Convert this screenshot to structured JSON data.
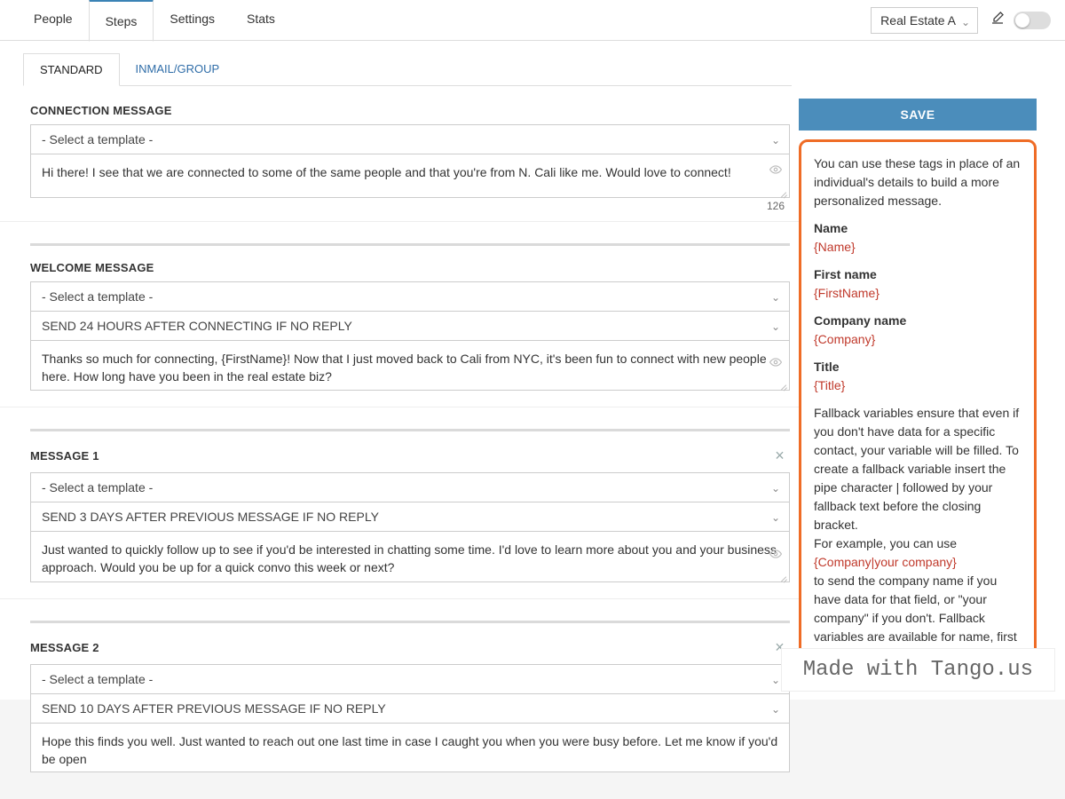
{
  "nav": {
    "people": "People",
    "steps": "Steps",
    "settings": "Settings",
    "stats": "Stats"
  },
  "campaign_selected": "Real Estate A",
  "secondary_tabs": {
    "standard": "STANDARD",
    "inmail": "INMAIL/GROUP"
  },
  "select_template_placeholder": "- Select a template -",
  "connection": {
    "title": "CONNECTION MESSAGE",
    "body": "Hi there! I see that we are connected to some of the same people and that you're from N. Cali like me. Would love to connect!",
    "count": "126"
  },
  "welcome": {
    "title": "WELCOME MESSAGE",
    "timing": "SEND 24 HOURS AFTER CONNECTING IF NO REPLY",
    "body": "Thanks so much for connecting, {FirstName}! Now that I just moved back to Cali from NYC, it's been fun to connect with new people here. How long have you been in the real estate biz?"
  },
  "msg1": {
    "title": "MESSAGE 1",
    "timing": "SEND 3 DAYS AFTER PREVIOUS MESSAGE IF NO REPLY",
    "body": "Just wanted to quickly follow up to see if you'd be interested in chatting some time. I'd love to learn more about you and your business approach. Would you be up for a quick convo this week or next?"
  },
  "msg2": {
    "title": "MESSAGE 2",
    "timing": "SEND 10 DAYS AFTER PREVIOUS MESSAGE IF NO REPLY",
    "body": "Hope this finds you well. Just wanted to reach out one last time in case I caught you when you were busy before. Let me know if you'd be open"
  },
  "save_label": "SAVE",
  "help": {
    "intro": "You can use these tags in place of an individual's details to build a more personalized message.",
    "name_lbl": "Name",
    "name_tag": "{Name}",
    "first_lbl": "First name",
    "first_tag": "{FirstName}",
    "company_lbl": "Company name",
    "company_tag": "{Company}",
    "title_lbl": "Title",
    "title_tag": "{Title}",
    "fallback1": "Fallback variables ensure that even if you don't have data for a specific contact, your variable will be filled. To create a fallback variable insert the pipe character | followed by your fallback text before the closing bracket.",
    "fallback2a": "For example, you can use",
    "fallback_tag": "{Company|your company}",
    "fallback2b": "to send the company name if you have data for that field, or \"your company\" if you don't. Fallback variables are available for name, first name, company, title."
  },
  "watermark": "Made with Tango.us"
}
